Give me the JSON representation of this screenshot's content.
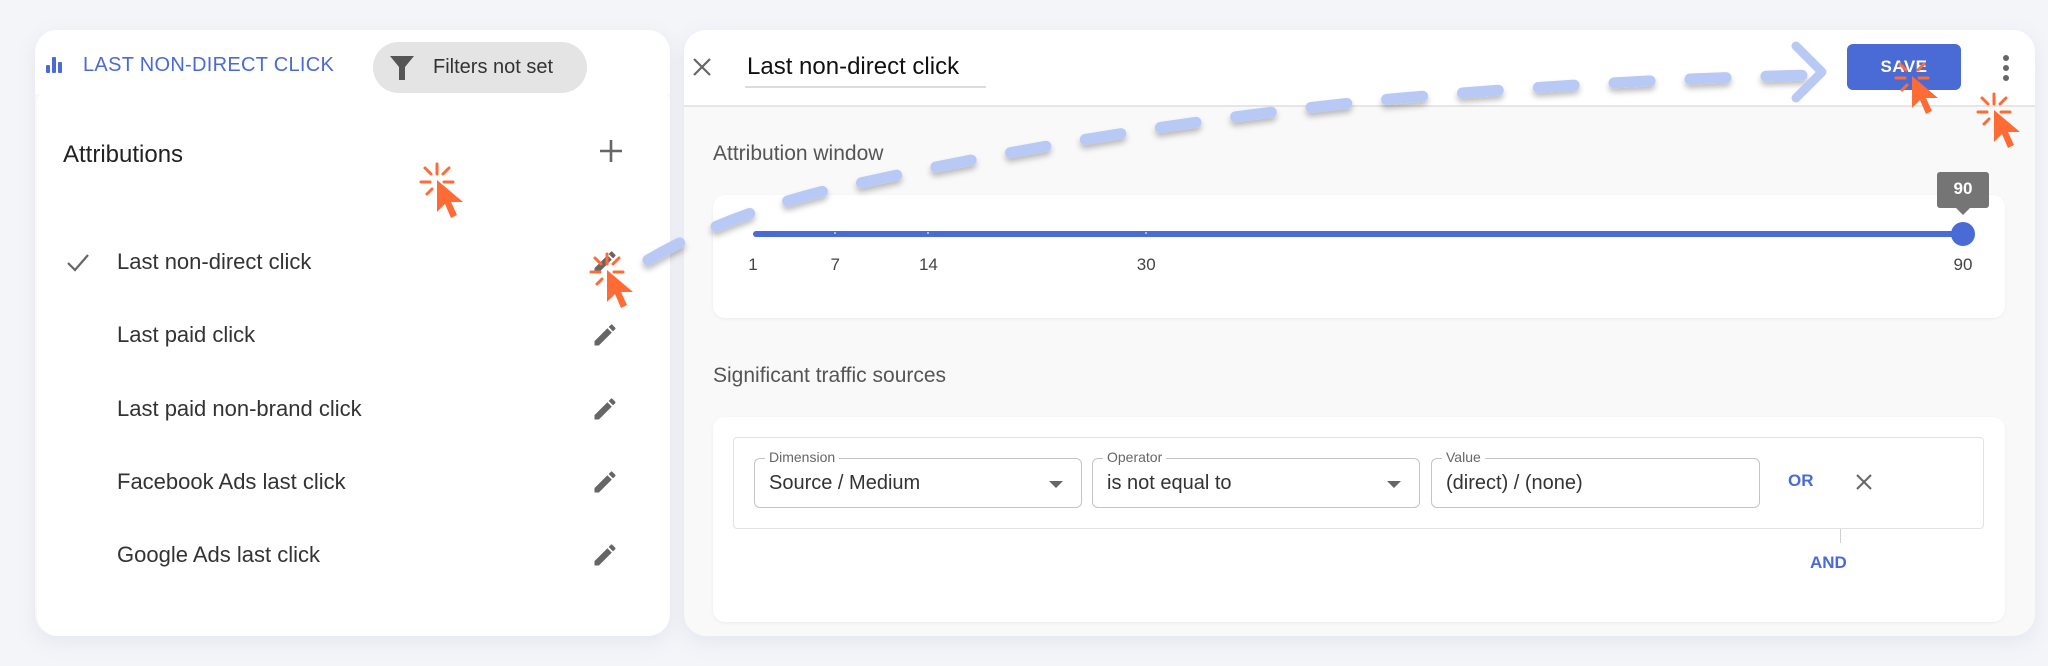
{
  "left_panel": {
    "report_icon": "bar-chart-icon",
    "report_title": "LAST NON-DIRECT CLICK",
    "filter_chip": {
      "icon": "funnel-icon",
      "label": "Filters not set"
    },
    "attributions_heading": "Attributions",
    "add_icon": "plus-icon",
    "items": [
      {
        "label": "Last non-direct click",
        "selected": true,
        "edit_icon": "pencil-icon"
      },
      {
        "label": "Last paid click",
        "selected": false,
        "edit_icon": "pencil-icon"
      },
      {
        "label": "Last paid non-brand click",
        "selected": false,
        "edit_icon": "pencil-icon"
      },
      {
        "label": "Facebook Ads last click",
        "selected": false,
        "edit_icon": "pencil-icon"
      },
      {
        "label": "Google Ads last click",
        "selected": false,
        "edit_icon": "pencil-icon"
      }
    ]
  },
  "editor": {
    "close_icon": "close-icon",
    "title_value": "Last non-direct click",
    "save_label": "SAVE",
    "more_icon": "kebab-icon",
    "attribution_window": {
      "label": "Attribution window",
      "ticks": [
        "1",
        "7",
        "14",
        "30",
        "90"
      ],
      "value": 90,
      "tooltip": "90"
    },
    "traffic_sources": {
      "label": "Significant traffic sources",
      "rule": {
        "dimension": {
          "label": "Dimension",
          "value": "Source / Medium"
        },
        "operator": {
          "label": "Operator",
          "value": "is not equal to"
        },
        "value": {
          "label": "Value",
          "value": "(direct) / (none)"
        },
        "or_label": "OR",
        "remove_icon": "close-icon"
      },
      "and_label": "AND"
    }
  },
  "colors": {
    "accent": "#4a6bd6",
    "cursor": "#ff6b35",
    "arrow": "#b8c9f5",
    "tooltip": "#757575"
  }
}
